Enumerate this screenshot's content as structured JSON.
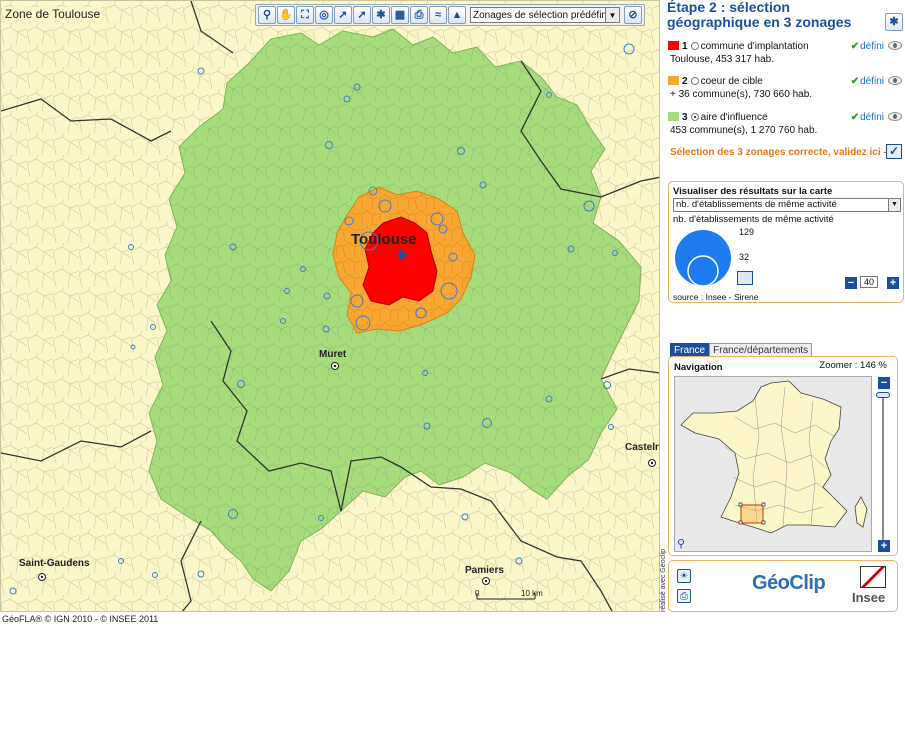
{
  "map": {
    "title": "Zone de Toulouse",
    "zonage_select": "Zonages de sélection prédéfini...",
    "cities": {
      "toulouse": "Toulouse",
      "muret": "Muret",
      "castelnau": "Casteln",
      "saint_gaudens": "Saint-Gaudens",
      "pamiers": "Pamiers"
    },
    "scale_start": "0",
    "scale_end": "10 km",
    "copyright": "GéoFLA® © IGN 2010  -  © INSEE 2011",
    "colors": {
      "background": "#fbf7c8",
      "zone1": "#ff0000",
      "zone2": "#f8a832",
      "zone3": "#a6dc7c",
      "circles": "#3a7fd6"
    }
  },
  "toolbar_icons": [
    "zoom-icon",
    "pan-hand-icon",
    "full-extent-icon",
    "zoom-area-icon",
    "select-point-icon",
    "select-line-icon",
    "select-star-icon",
    "save-icon",
    "print-icon",
    "layers-icon",
    "road-icon",
    "clear-icon"
  ],
  "panel": {
    "step_title": "Étape 2 : sélection géographique en 3 zonages",
    "zones": [
      {
        "num": "1",
        "name": "commune d'implantation",
        "status": "défini",
        "desc": "Toulouse, 453 317 hab.",
        "color": "#ff0000",
        "selected": false
      },
      {
        "num": "2",
        "name": "coeur de cible",
        "status": "défini",
        "desc": "+ 36 commune(s), 730 660 hab.",
        "color": "#f8a832",
        "selected": false
      },
      {
        "num": "3",
        "name": "aire d'influence",
        "status": "défini",
        "desc": "453 commune(s), 1 270 760 hab.",
        "color": "#a6dc7c",
        "selected": true
      }
    ],
    "validate": "Sélection des 3 zonages correcte, validez ici -->"
  },
  "results": {
    "header": "Visualiser des résultats sur la carte",
    "select_value": "nb. d'établissements de même activité",
    "subtitle": "nb. d'établissements de même activité",
    "max_value": "129",
    "min_value": "32",
    "size_value": "40",
    "source": "source : Insee - Sirene"
  },
  "navigation": {
    "tab_active": "France",
    "tab_inactive": "France/départements",
    "header": "Navigation",
    "zoom": "Zoomer : 146 %",
    "zoom_level": 146
  },
  "footer": {
    "vertical_credit": "réalisé avec Géoclip",
    "geoclip": "GéoClip",
    "insee": "Insee"
  }
}
